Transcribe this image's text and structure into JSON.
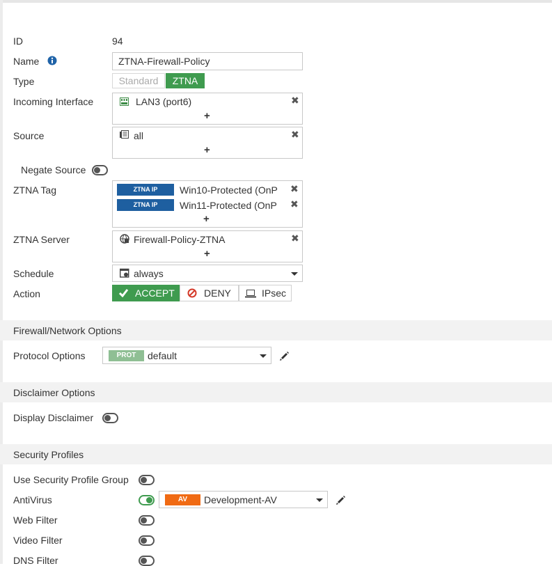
{
  "fields": {
    "id": {
      "label": "ID",
      "value": "94"
    },
    "name": {
      "label": "Name",
      "value": "ZTNA-Firewall-Policy"
    },
    "type": {
      "label": "Type",
      "options": [
        "Standard",
        "ZTNA"
      ],
      "selected": "ZTNA"
    },
    "incoming_interface": {
      "label": "Incoming Interface",
      "value": "LAN3 (port6)"
    },
    "source": {
      "label": "Source",
      "value": "all"
    },
    "negate_source": {
      "label": "Negate Source",
      "enabled": false
    },
    "ztna_tag": {
      "label": "ZTNA Tag",
      "items": [
        {
          "badge": "ZTNA IP",
          "value": "Win10-Protected (OnP"
        },
        {
          "badge": "ZTNA IP",
          "value": "Win11-Protected (OnP"
        }
      ]
    },
    "ztna_server": {
      "label": "ZTNA Server",
      "value": "Firewall-Policy-ZTNA"
    },
    "schedule": {
      "label": "Schedule",
      "value": "always"
    },
    "action": {
      "label": "Action",
      "options": [
        "ACCEPT",
        "DENY",
        "IPsec"
      ],
      "selected": "ACCEPT"
    }
  },
  "firewall_section": {
    "title": "Firewall/Network Options",
    "protocol_options": {
      "label": "Protocol Options",
      "badge": "PROT",
      "value": "default"
    }
  },
  "disclaimer_section": {
    "title": "Disclaimer Options",
    "display_disclaimer": {
      "label": "Display Disclaimer",
      "enabled": false
    }
  },
  "security_section": {
    "title": "Security Profiles",
    "rows": [
      {
        "label": "Use Security Profile Group",
        "enabled": false
      },
      {
        "label": "AntiVirus",
        "enabled": true,
        "badge": "AV",
        "value": "Development-AV"
      },
      {
        "label": "Web Filter",
        "enabled": false
      },
      {
        "label": "Video Filter",
        "enabled": false
      },
      {
        "label": "DNS Filter",
        "enabled": false
      }
    ]
  },
  "colors": {
    "accent_green": "#3f9b4f",
    "ztna_badge_blue": "#1e5fa0",
    "deny_red": "#d43a2a",
    "prot_badge": "#8fbf94",
    "av_badge": "#f06a13",
    "section_bg": "#f2f2f2"
  },
  "icons": {
    "info": "info-icon",
    "interface": "interface-port-icon",
    "address": "address-icon",
    "server": "ztna-server-icon",
    "schedule": "schedule-icon",
    "accept": "checkmark-icon",
    "deny": "deny-icon",
    "ipsec": "laptop-icon",
    "edit": "pencil-icon",
    "remove": "close-icon"
  }
}
